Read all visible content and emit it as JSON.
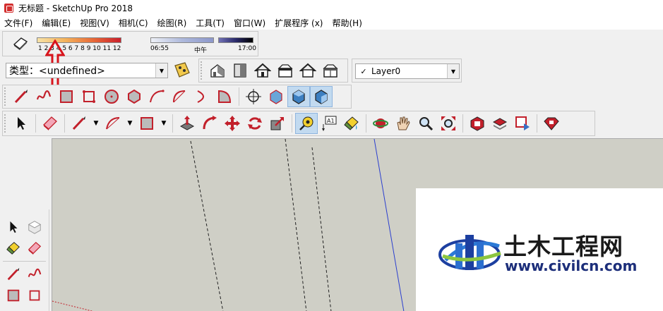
{
  "window": {
    "title": "无标题 - SketchUp Pro 2018"
  },
  "menu": {
    "items": [
      "文件(F)",
      "编辑(E)",
      "视图(V)",
      "相机(C)",
      "绘图(R)",
      "工具(T)",
      "窗口(W)",
      "扩展程序 (x)",
      "帮助(H)"
    ]
  },
  "shadows": {
    "scale_numbers": "1 2 3 4 5 6 7 8 9 10 11 12",
    "time_start": "06:55",
    "time_mid": "中午",
    "time_end": "17:00"
  },
  "type_selector": {
    "label": "类型：<undefined>"
  },
  "layer": {
    "current": "Layer0",
    "check": "✓"
  },
  "icons": {
    "views": [
      "iso-view-icon",
      "top-view-icon",
      "front-view-icon",
      "right-view-icon",
      "back-view-icon",
      "left-view-icon"
    ],
    "drawing": [
      "line-icon",
      "freehand-icon",
      "rectangle-icon",
      "rotated-rectangle-icon",
      "circle-icon",
      "polygon-icon",
      "arc-icon",
      "2pt-arc-icon",
      "3pt-arc-icon",
      "pie-icon"
    ],
    "camera_style": [
      "position-camera-icon",
      "xray-icon",
      "back-edges-icon",
      "wireframe-icon"
    ]
  },
  "colors": {
    "red": "#c2202b",
    "selected": "#c2daf0",
    "canvas": "#cfcfc6",
    "watermark_blue": "#1c2e7a",
    "axis_blue": "#2b3fcf"
  },
  "watermark": {
    "name": "土木工程网",
    "url": "www.civilcn.com"
  }
}
